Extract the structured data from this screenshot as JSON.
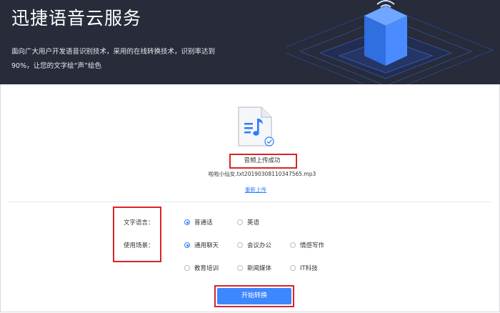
{
  "hero": {
    "title": "迅捷语音云服务",
    "description_line1": "面向广大用户开发语音识别技术，采用的在线转换技术，识别率达到",
    "description_line2": "90%，让您的文字绘“声”绘色",
    "background_color": "#272b3a",
    "art_color": "#3d87ff"
  },
  "upload": {
    "status": "音频上传成功",
    "filename": "啦啦小仙女.txt20190308110347565.mp3",
    "reupload_link": "重新上传",
    "file_icon": "music-file-icon"
  },
  "settings": {
    "language_label": "文字语言：",
    "language_options": [
      {
        "label": "普通话",
        "selected": true
      },
      {
        "label": "英语",
        "selected": false
      }
    ],
    "scene_label": "使用场景：",
    "scene_options": [
      {
        "label": "通用聊天",
        "selected": true
      },
      {
        "label": "会议办公",
        "selected": false
      },
      {
        "label": "情感写作",
        "selected": false
      },
      {
        "label": "教育培训",
        "selected": false
      },
      {
        "label": "新闻媒体",
        "selected": false
      },
      {
        "label": "IT科技",
        "selected": false
      }
    ]
  },
  "actions": {
    "start_label": "开始转换"
  },
  "colors": {
    "accent": "#3d87ff",
    "highlight_box": "#d8232a"
  }
}
